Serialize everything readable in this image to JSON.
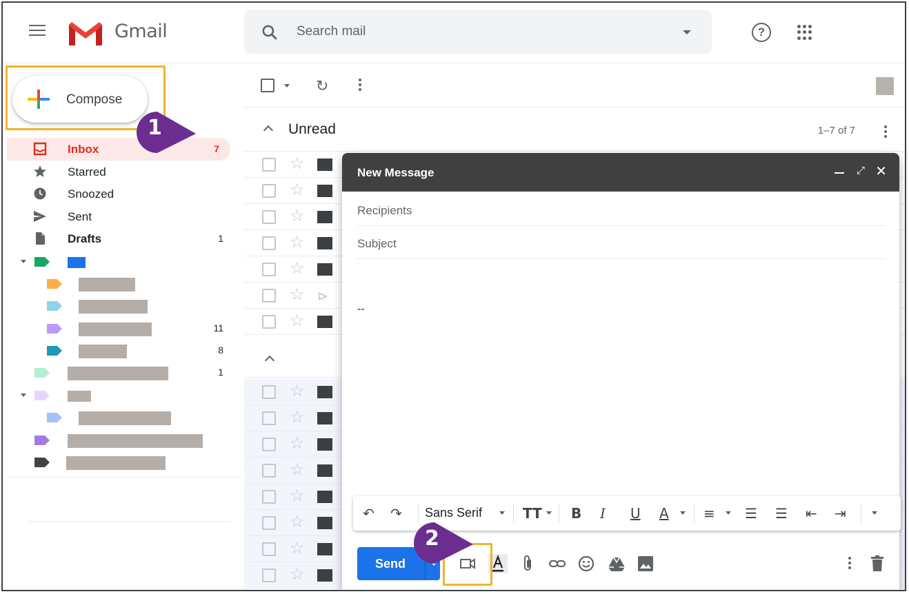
{
  "header": {
    "brand": "Gmail",
    "search_placeholder": "Search mail",
    "help_glyph": "?"
  },
  "sidebar": {
    "compose_label": "Compose",
    "items": [
      {
        "label": "Inbox",
        "count": "7",
        "icon": "inbox-icon"
      },
      {
        "label": "Starred",
        "count": "",
        "icon": "star-icon"
      },
      {
        "label": "Snoozed",
        "count": "",
        "icon": "clock-icon"
      },
      {
        "label": "Sent",
        "count": "",
        "icon": "send-icon"
      },
      {
        "label": "Drafts",
        "count": "1",
        "icon": "file-icon"
      }
    ],
    "label_counts": [
      "11",
      "8",
      "1"
    ],
    "label_colors": [
      "#16a765",
      "#ffad47",
      "#8fd3e6",
      "#b99aff",
      "#1e9ab5",
      "#b3efd3",
      "#e3d7ff",
      "#a4c2f4",
      "#a479e2",
      "#434343"
    ],
    "label_bar_color": "#1a73e8"
  },
  "list": {
    "section_title": "Unread",
    "section_count": "1–7 of 7"
  },
  "compose_window": {
    "title": "New Message",
    "recipients_placeholder": "Recipients",
    "subject_placeholder": "Subject",
    "signature": "--",
    "font_name": "Sans Serif",
    "send_label": "Send",
    "accent": "#1a73e8"
  },
  "callouts": {
    "step1": "1",
    "step2": "2",
    "color": "#6b2d8f",
    "highlight_color": "#f0b429"
  }
}
